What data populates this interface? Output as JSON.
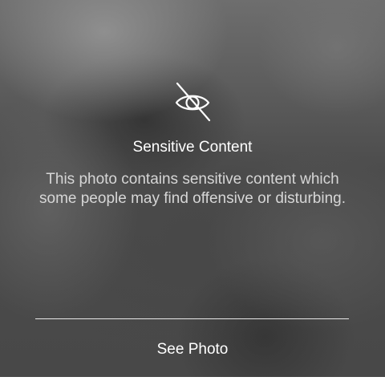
{
  "overlay": {
    "icon": "eye-slash-icon",
    "title": "Sensitive Content",
    "message": "This photo contains sensitive content which some people may find offensive or disturbing.",
    "action_label": "See Photo"
  }
}
